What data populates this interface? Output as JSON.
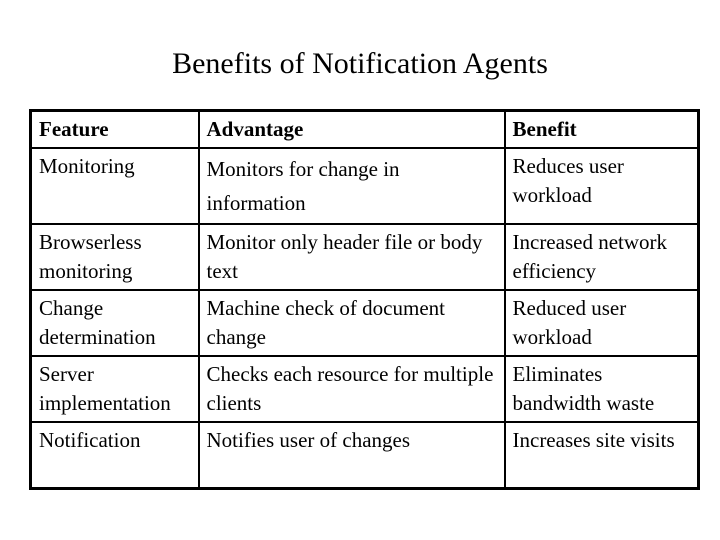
{
  "title": "Benefits of Notification Agents",
  "table": {
    "headers": {
      "feature": "Feature",
      "advantage": "Advantage",
      "benefit": "Benefit"
    },
    "rows": [
      {
        "feature": "Monitoring",
        "advantage": "Monitors for change in information",
        "benefit": "Reduces user workload"
      },
      {
        "feature": "Browserless monitoring",
        "advantage": "Monitor only header file or body text",
        "benefit": "Increased network efficiency"
      },
      {
        "feature": "Change determination",
        "advantage": "Machine check of document change",
        "benefit": "Reduced user workload"
      },
      {
        "feature": "Server implementation",
        "advantage": "Checks each resource for multiple clients",
        "benefit": "Eliminates bandwidth waste"
      },
      {
        "feature": "Notification",
        "advantage": "Notifies user of changes",
        "benefit": "Increases site visits"
      }
    ]
  }
}
